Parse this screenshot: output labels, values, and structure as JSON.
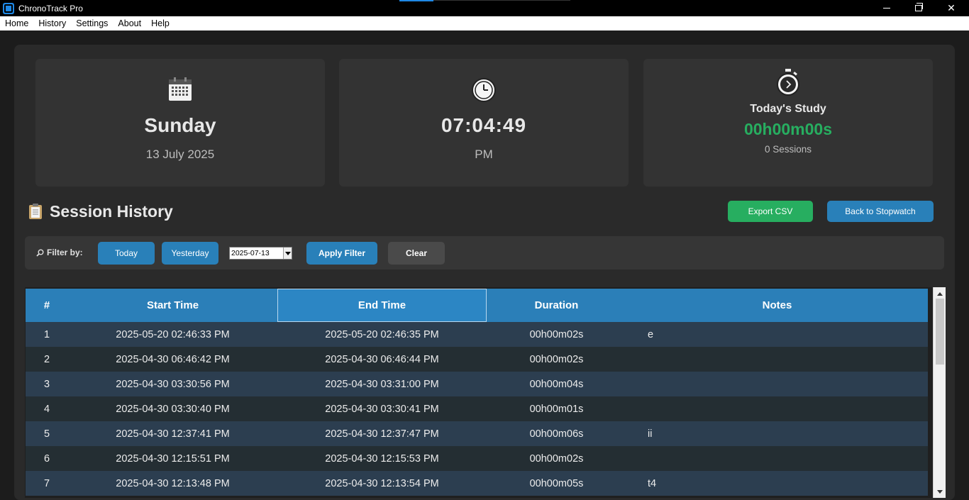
{
  "window": {
    "title": "ChronoTrack Pro"
  },
  "menu": [
    "Home",
    "History",
    "Settings",
    "About",
    "Help"
  ],
  "cards": {
    "day": {
      "icon": "calendar-icon",
      "weekday": "Sunday",
      "date": "13 July 2025"
    },
    "clock": {
      "icon": "clock-icon",
      "time": "07:04:49",
      "ampm": "PM"
    },
    "study": {
      "icon": "stopwatch-icon",
      "label": "Today's Study",
      "value": "00h00m00s",
      "sessions": "0 Sessions",
      "value_color": "#27ae60"
    }
  },
  "history": {
    "title": "Session History",
    "icon": "clipboard-icon",
    "export_label": "Export CSV",
    "back_label": "Back to Stopwatch"
  },
  "filter": {
    "label": "Filter by:",
    "today_label": "Today",
    "yesterday_label": "Yesterday",
    "date_value": "2025-07-13",
    "apply_label": "Apply Filter",
    "clear_label": "Clear"
  },
  "table": {
    "headers": [
      "#",
      "Start Time",
      "End Time",
      "Duration",
      "Notes"
    ],
    "rows": [
      [
        "1",
        "2025-05-20 02:46:33 PM",
        "2025-05-20 02:46:35 PM",
        "00h00m02s",
        "e"
      ],
      [
        "2",
        "2025-04-30 06:46:42 PM",
        "2025-04-30 06:46:44 PM",
        "00h00m02s",
        ""
      ],
      [
        "3",
        "2025-04-30 03:30:56 PM",
        "2025-04-30 03:31:00 PM",
        "00h00m04s",
        ""
      ],
      [
        "4",
        "2025-04-30 03:30:40 PM",
        "2025-04-30 03:30:41 PM",
        "00h00m01s",
        ""
      ],
      [
        "5",
        "2025-04-30 12:37:41 PM",
        "2025-04-30 12:37:47 PM",
        "00h00m06s",
        "ii"
      ],
      [
        "6",
        "2025-04-30 12:15:51 PM",
        "2025-04-30 12:15:53 PM",
        "00h00m02s",
        ""
      ],
      [
        "7",
        "2025-04-30 12:13:48 PM",
        "2025-04-30 12:13:54 PM",
        "00h00m05s",
        "t4"
      ]
    ]
  },
  "colors": {
    "accent_blue": "#2980b9",
    "accent_green": "#27ae60",
    "header_blue": "#2b7fb8"
  }
}
